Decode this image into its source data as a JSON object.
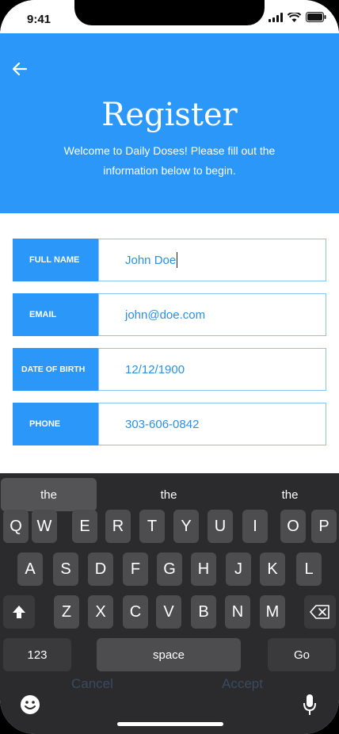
{
  "status_bar": {
    "time": "9:41"
  },
  "header": {
    "title": "Register",
    "subtitle": "Welcome to Daily Doses! Please fill out the information below to begin."
  },
  "form": {
    "fields": [
      {
        "label": "FULL NAME",
        "value": "John Doe"
      },
      {
        "label": "EMAIL",
        "value": "john@doe.com"
      },
      {
        "label": "DATE OF BIRTH",
        "value": "12/12/1900"
      },
      {
        "label": "PHONE",
        "value": "303-606-0842"
      }
    ],
    "cancel_label": "Cancel",
    "accept_label": "Accept"
  },
  "keyboard": {
    "suggestions": [
      "the",
      "the",
      "the"
    ],
    "row1": [
      "Q",
      "W",
      "E",
      "R",
      "T",
      "Y",
      "U",
      "I",
      "O",
      "P"
    ],
    "row2": [
      "A",
      "S",
      "D",
      "F",
      "G",
      "H",
      "J",
      "K",
      "L"
    ],
    "row3": [
      "Z",
      "X",
      "C",
      "V",
      "B",
      "N",
      "M"
    ],
    "numbers_label": "123",
    "space_label": "space",
    "go_label": "Go",
    "icons": {
      "shift": "shift-icon",
      "backspace": "backspace-icon",
      "emoji": "emoji-icon",
      "mic": "microphone-icon"
    }
  },
  "colors": {
    "accent": "#2a97f9",
    "keyboard_bg": "#2b2b2d",
    "key_bg": "#4d4d4f"
  }
}
